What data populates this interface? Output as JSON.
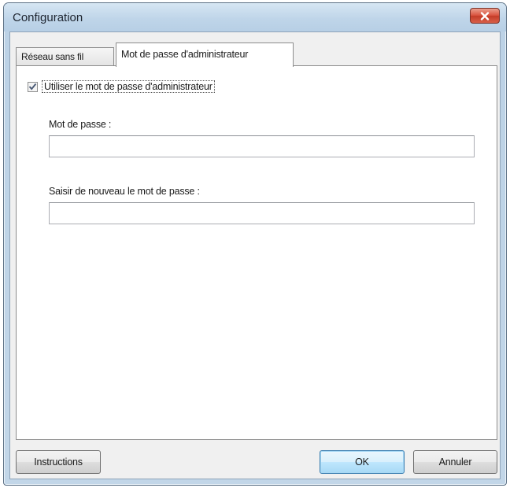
{
  "window": {
    "title": "Configuration",
    "close_icon": "close-icon"
  },
  "tabs": [
    {
      "label": "Réseau sans fil",
      "active": false
    },
    {
      "label": "Mot de passe d'administrateur",
      "active": true
    }
  ],
  "admin_password_tab": {
    "use_password_checkbox": {
      "label": "Utiliser le mot de passe d'administrateur",
      "checked": true
    },
    "password_field": {
      "label": "Mot de passe :",
      "value": ""
    },
    "confirm_field": {
      "label": "Saisir de nouveau le mot de passe :",
      "value": ""
    }
  },
  "buttons": {
    "instructions": "Instructions",
    "ok": "OK",
    "cancel": "Annuler"
  },
  "colors": {
    "close_button": "#d9533f",
    "default_button_border": "#3c7fb1"
  }
}
